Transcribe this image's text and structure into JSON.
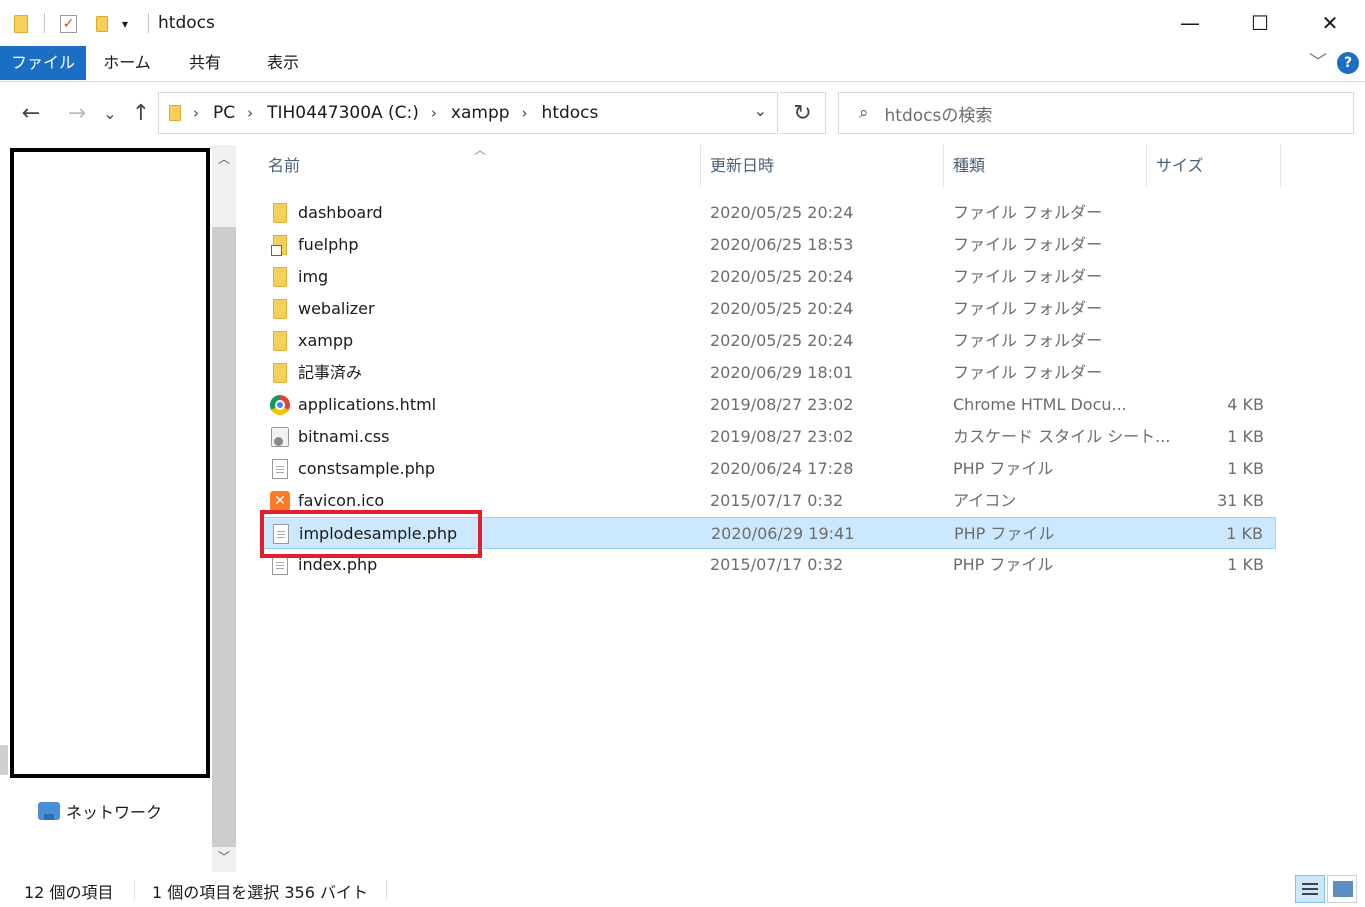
{
  "window": {
    "title": "htdocs",
    "minimize": "—",
    "maximize": "☐",
    "close": "✕"
  },
  "ribbon": {
    "tabs": [
      "ファイル",
      "ホーム",
      "共有",
      "表示"
    ],
    "help": "?",
    "expand": "﹀"
  },
  "nav": {
    "back": "←",
    "forward": "→",
    "recent": "⌄",
    "up": "↑",
    "breadcrumb": [
      "PC",
      "TIH0447300A (C:)",
      "xampp",
      "htdocs"
    ],
    "crumb_sep": "›",
    "address_dropdown": "⌄",
    "refresh": "↻",
    "search_placeholder": "htdocsの検索"
  },
  "sidebar": {
    "network_label": "ネットワーク",
    "scroll_up": "︿",
    "scroll_down": "﹀"
  },
  "columns": {
    "name": "名前",
    "date": "更新日時",
    "type": "種類",
    "size": "サイズ",
    "sort_indicator": "︿"
  },
  "files": [
    {
      "name": "dashboard",
      "date": "2020/05/25 20:24",
      "type": "ファイル フォルダー",
      "size": "",
      "icon": "folder-icon"
    },
    {
      "name": "fuelphp",
      "date": "2020/06/25 18:53",
      "type": "ファイル フォルダー",
      "size": "",
      "icon": "folder-shortcut-icon"
    },
    {
      "name": "img",
      "date": "2020/05/25 20:24",
      "type": "ファイル フォルダー",
      "size": "",
      "icon": "folder-icon"
    },
    {
      "name": "webalizer",
      "date": "2020/05/25 20:24",
      "type": "ファイル フォルダー",
      "size": "",
      "icon": "folder-icon"
    },
    {
      "name": "xampp",
      "date": "2020/05/25 20:24",
      "type": "ファイル フォルダー",
      "size": "",
      "icon": "folder-icon"
    },
    {
      "name": "記事済み",
      "date": "2020/06/29 18:01",
      "type": "ファイル フォルダー",
      "size": "",
      "icon": "folder-icon"
    },
    {
      "name": "applications.html",
      "date": "2019/08/27 23:02",
      "type": "Chrome HTML Docu...",
      "size": "4 KB",
      "icon": "chrome-icon"
    },
    {
      "name": "bitnami.css",
      "date": "2019/08/27 23:02",
      "type": "カスケード スタイル シート...",
      "size": "1 KB",
      "icon": "css-file-icon"
    },
    {
      "name": "constsample.php",
      "date": "2020/06/24 17:28",
      "type": "PHP ファイル",
      "size": "1 KB",
      "icon": "php-file-icon"
    },
    {
      "name": "favicon.ico",
      "date": "2015/07/17 0:32",
      "type": "アイコン",
      "size": "31 KB",
      "icon": "xampp-icon"
    },
    {
      "name": "implodesample.php",
      "date": "2020/06/29 19:41",
      "type": "PHP ファイル",
      "size": "1 KB",
      "icon": "php-file-icon"
    },
    {
      "name": "index.php",
      "date": "2015/07/17 0:32",
      "type": "PHP ファイル",
      "size": "1 KB",
      "icon": "php-file-icon"
    }
  ],
  "status": {
    "item_count": "12 個の項目",
    "selection": "1 個の項目を選択  356 バイト"
  },
  "colors": {
    "accent": "#1a6fc5",
    "selection": "#cce8ff",
    "highlight_box": "#e0202e"
  }
}
